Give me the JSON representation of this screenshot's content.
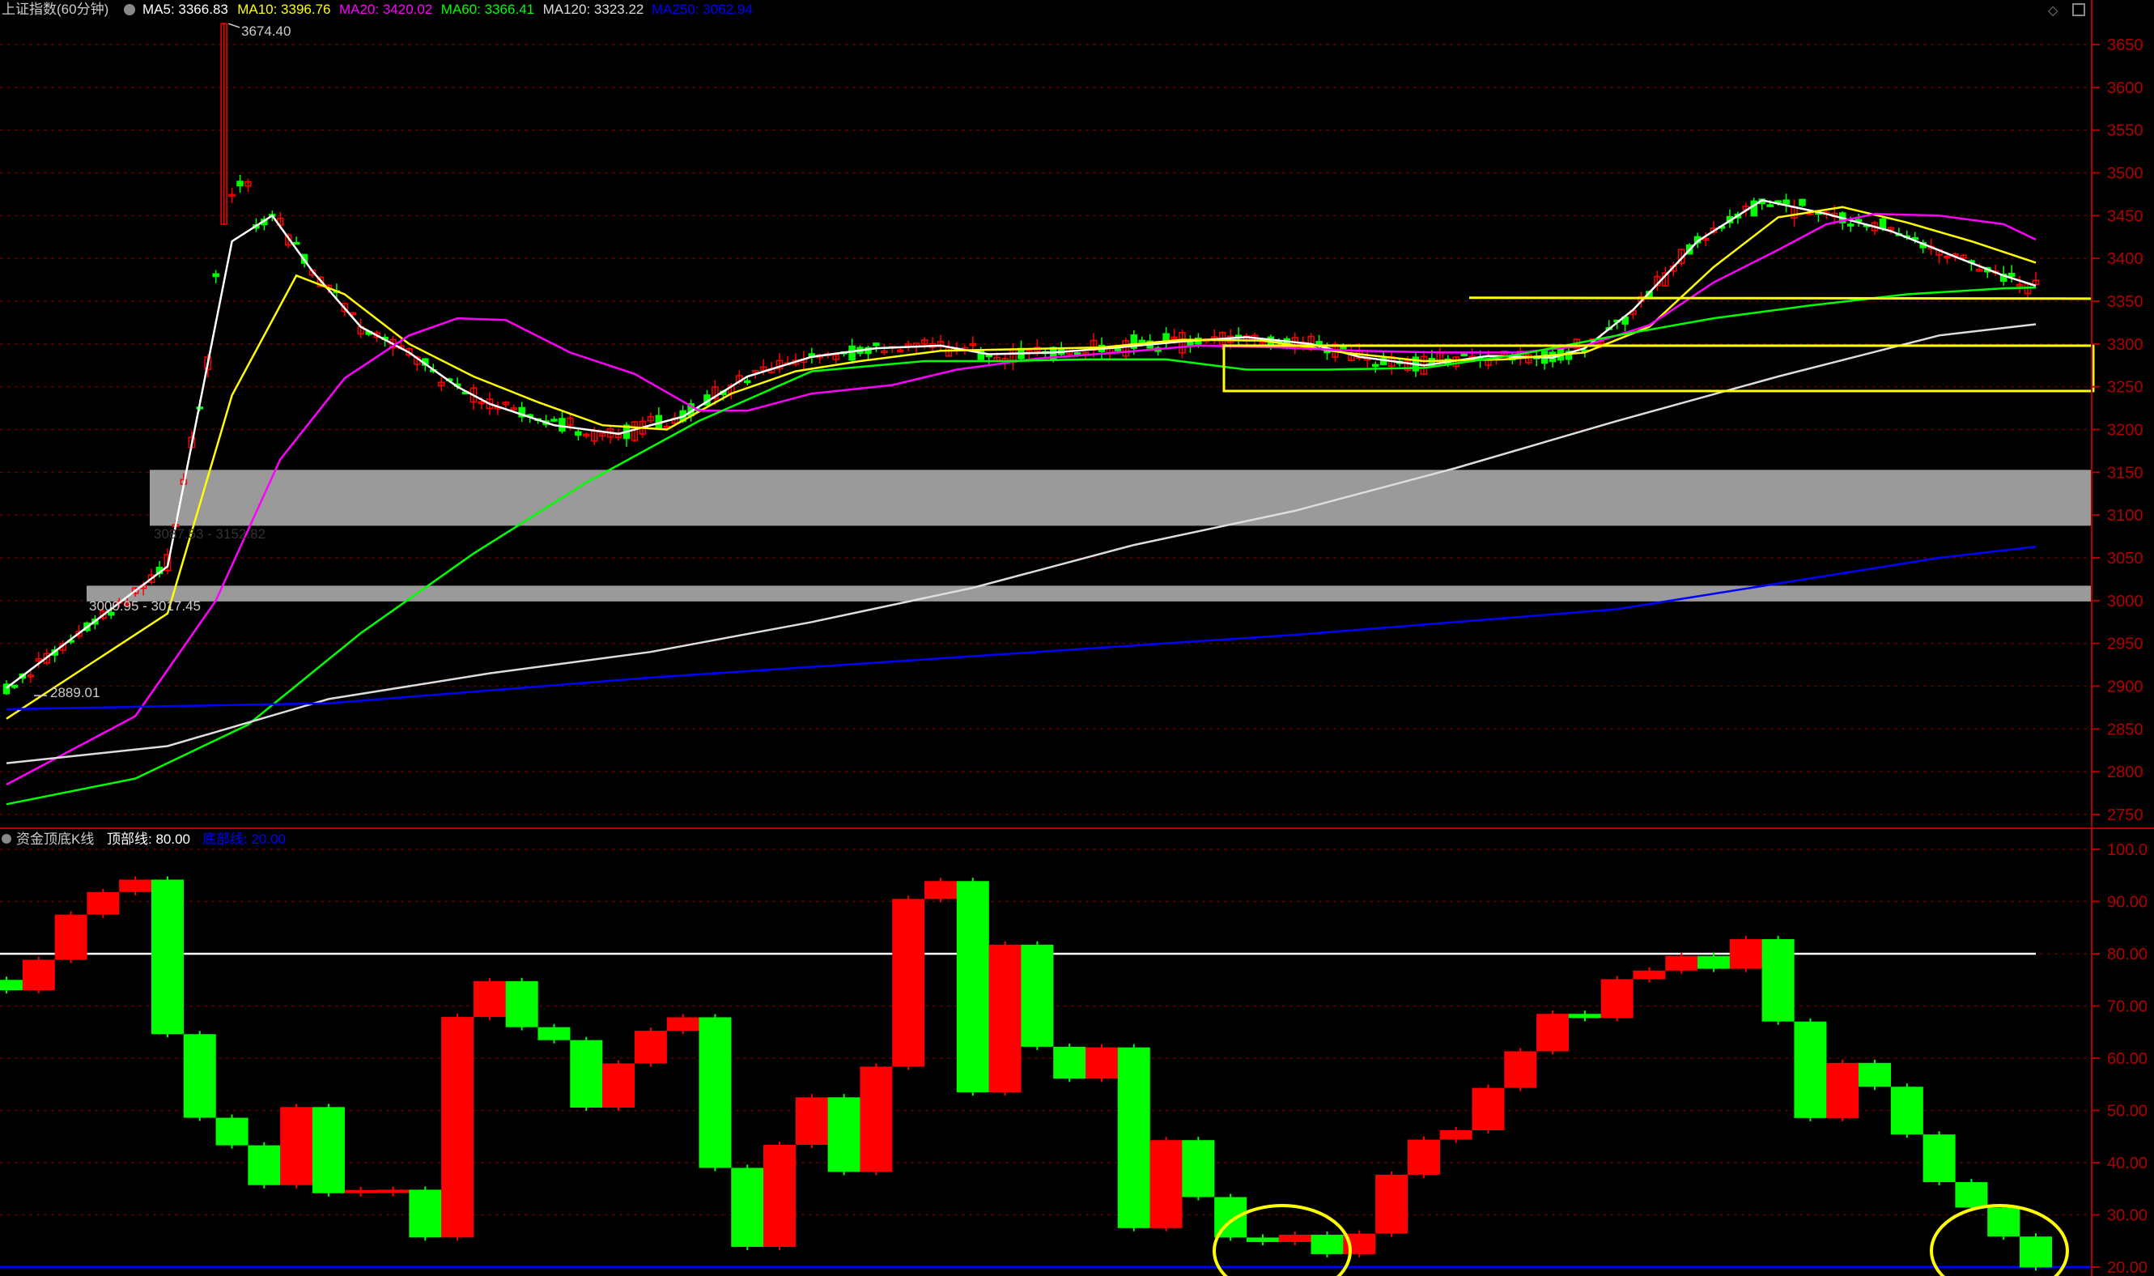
{
  "upper_panel": {
    "title": "上证指数(60分钟)",
    "legend": [
      {
        "label": "MA5: 3366.83",
        "color": "#ffffff"
      },
      {
        "label": "MA10: 3396.76",
        "color": "#ffff00"
      },
      {
        "label": "MA20: 3420.02",
        "color": "#ff00ff"
      },
      {
        "label": "MA60: 3366.41",
        "color": "#00ff00"
      },
      {
        "label": "MA120: 3323.22",
        "color": "#dddddd"
      },
      {
        "label": "MA250: 3062.94",
        "color": "#0000ff"
      }
    ],
    "annotations": {
      "high": "3674.40",
      "low": "2889.01",
      "band1": "3087.53 - 3152.82",
      "band2": "3000.95 - 3017.45"
    },
    "y_ticks": [
      "3650",
      "3600",
      "3550",
      "3500",
      "3450",
      "3400",
      "3350",
      "3300",
      "3250",
      "3200",
      "3150",
      "3100",
      "3050",
      "3000",
      "2950",
      "2900",
      "2850",
      "2800",
      "2750"
    ]
  },
  "lower_panel": {
    "title": "资金顶底K线",
    "top_line": {
      "label": "顶部线: 80.00",
      "color": "#ffffff"
    },
    "bottom_line": {
      "label": "底部线: 20.00",
      "color": "#0000ff"
    },
    "y_ticks": [
      "100.0",
      "90.00",
      "80.00",
      "70.00",
      "60.00",
      "50.00",
      "40.00",
      "30.00",
      "20.00"
    ]
  },
  "colors": {
    "up": "#ff0000",
    "down": "#00ff00",
    "grid": "#5a0000",
    "axis": "#b00000",
    "box": "#ffff00",
    "band": "#9a9a9a"
  },
  "chart_data": [
    {
      "type": "candlestick",
      "title": "上证指数(60分钟)",
      "ylim": [
        2730,
        3690
      ],
      "annotations": {
        "high": 3674.4,
        "low": 2889.01,
        "band1": [
          3087.53,
          3152.82
        ],
        "band2": [
          3000.95,
          3017.45
        ]
      },
      "series": [
        {
          "name": "MA5",
          "points": [
            [
              0,
              2898
            ],
            [
              20,
              3040
            ],
            [
              28,
              3420
            ],
            [
              33,
              3450
            ],
            [
              38,
              3385
            ],
            [
              44,
              3320
            ],
            [
              50,
              3290
            ],
            [
              56,
              3250
            ],
            [
              60,
              3230
            ],
            [
              68,
              3205
            ],
            [
              76,
              3195
            ],
            [
              84,
              3215
            ],
            [
              92,
              3262
            ],
            [
              100,
              3285
            ],
            [
              108,
              3295
            ],
            [
              116,
              3298
            ],
            [
              122,
              3288
            ],
            [
              130,
              3290
            ],
            [
              138,
              3296
            ],
            [
              146,
              3303
            ],
            [
              154,
              3308
            ],
            [
              162,
              3300
            ],
            [
              168,
              3285
            ],
            [
              176,
              3275
            ],
            [
              184,
              3286
            ],
            [
              192,
              3284
            ],
            [
              196,
              3295
            ],
            [
              202,
              3340
            ],
            [
              210,
              3420
            ],
            [
              218,
              3468
            ],
            [
              226,
              3452
            ],
            [
              234,
              3432
            ],
            [
              242,
              3402
            ],
            [
              248,
              3380
            ],
            [
              252,
              3368
            ]
          ]
        },
        {
          "name": "MA10",
          "points": [
            [
              0,
              2862
            ],
            [
              20,
              2985
            ],
            [
              28,
              3240
            ],
            [
              36,
              3380
            ],
            [
              42,
              3358
            ],
            [
              50,
              3300
            ],
            [
              58,
              3262
            ],
            [
              66,
              3232
            ],
            [
              74,
              3205
            ],
            [
              82,
              3200
            ],
            [
              90,
              3242
            ],
            [
              98,
              3268
            ],
            [
              106,
              3280
            ],
            [
              116,
              3292
            ],
            [
              126,
              3294
            ],
            [
              136,
              3296
            ],
            [
              146,
              3305
            ],
            [
              156,
              3304
            ],
            [
              166,
              3290
            ],
            [
              176,
              3280
            ],
            [
              186,
              3282
            ],
            [
              196,
              3290
            ],
            [
              204,
              3320
            ],
            [
              212,
              3390
            ],
            [
              220,
              3448
            ],
            [
              228,
              3460
            ],
            [
              236,
              3442
            ],
            [
              244,
              3420
            ],
            [
              252,
              3395
            ]
          ]
        },
        {
          "name": "MA20",
          "points": [
            [
              0,
              2785
            ],
            [
              16,
              2865
            ],
            [
              26,
              3000
            ],
            [
              34,
              3165
            ],
            [
              42,
              3260
            ],
            [
              50,
              3310
            ],
            [
              56,
              3330
            ],
            [
              62,
              3328
            ],
            [
              70,
              3290
            ],
            [
              78,
              3265
            ],
            [
              86,
              3222
            ],
            [
              92,
              3222
            ],
            [
              100,
              3242
            ],
            [
              110,
              3252
            ],
            [
              118,
              3270
            ],
            [
              128,
              3283
            ],
            [
              138,
              3290
            ],
            [
              148,
              3298
            ],
            [
              158,
              3296
            ],
            [
              168,
              3292
            ],
            [
              178,
              3290
            ],
            [
              188,
              3290
            ],
            [
              196,
              3298
            ],
            [
              204,
              3322
            ],
            [
              212,
              3372
            ],
            [
              220,
              3410
            ],
            [
              226,
              3440
            ],
            [
              232,
              3452
            ],
            [
              240,
              3450
            ],
            [
              248,
              3440
            ],
            [
              252,
              3422
            ]
          ]
        },
        {
          "name": "MA60",
          "points": [
            [
              0,
              2762
            ],
            [
              16,
              2792
            ],
            [
              30,
              2855
            ],
            [
              44,
              2962
            ],
            [
              58,
              3055
            ],
            [
              72,
              3138
            ],
            [
              86,
              3210
            ],
            [
              100,
              3268
            ],
            [
              114,
              3280
            ],
            [
              124,
              3280
            ],
            [
              134,
              3282
            ],
            [
              144,
              3282
            ],
            [
              154,
              3270
            ],
            [
              164,
              3270
            ],
            [
              176,
              3272
            ],
            [
              188,
              3288
            ],
            [
              200,
              3310
            ],
            [
              212,
              3330
            ],
            [
              224,
              3345
            ],
            [
              236,
              3358
            ],
            [
              248,
              3365
            ],
            [
              252,
              3366
            ]
          ]
        },
        {
          "name": "MA120",
          "points": [
            [
              0,
              2810
            ],
            [
              20,
              2830
            ],
            [
              40,
              2885
            ],
            [
              60,
              2915
            ],
            [
              80,
              2940
            ],
            [
              100,
              2975
            ],
            [
              120,
              3015
            ],
            [
              140,
              3065
            ],
            [
              160,
              3105
            ],
            [
              180,
              3155
            ],
            [
              200,
              3210
            ],
            [
              220,
              3262
            ],
            [
              240,
              3310
            ],
            [
              252,
              3323
            ]
          ]
        },
        {
          "name": "MA250",
          "points": [
            [
              0,
              2873
            ],
            [
              40,
              2880
            ],
            [
              80,
              2910
            ],
            [
              120,
              2935
            ],
            [
              160,
              2960
            ],
            [
              200,
              2990
            ],
            [
              240,
              3050
            ],
            [
              252,
              3063
            ]
          ]
        }
      ]
    },
    {
      "type": "candlestick",
      "title": "资金顶底K线",
      "ylim": [
        18,
        103
      ],
      "reference_lines": {
        "top": 80,
        "bottom": 20
      },
      "series": [
        {
          "name": "顶部线",
          "values": [
            80
          ]
        },
        {
          "name": "底部线",
          "values": [
            20
          ]
        }
      ]
    }
  ]
}
